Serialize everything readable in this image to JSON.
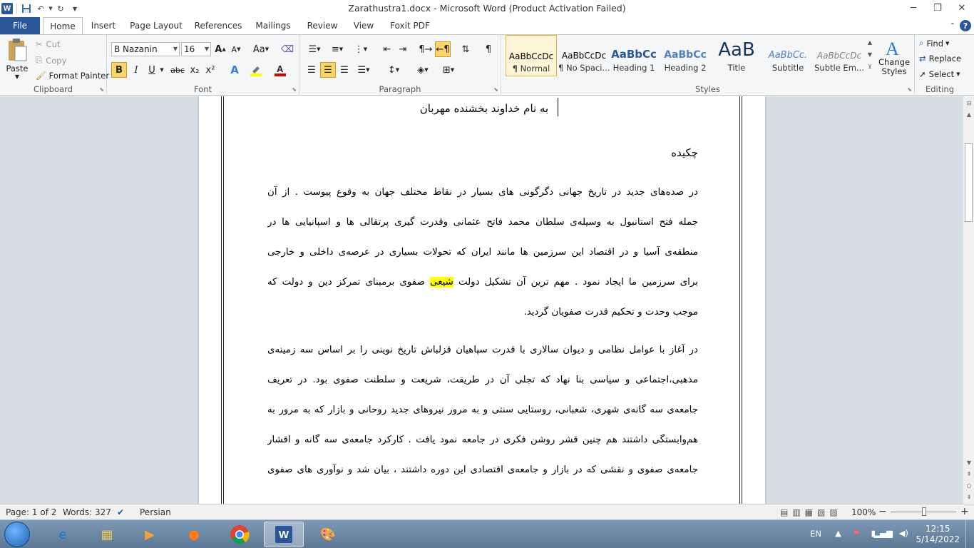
{
  "window": {
    "title": "Zarathustra1.docx  -  Microsoft Word (Product Activation Failed)",
    "minimize": "─",
    "restore": "❐",
    "close": "✕"
  },
  "qat": {
    "logo": "W",
    "save_icon": "save-icon",
    "undo_icon": "undo-icon",
    "redo_icon": "redo-icon"
  },
  "tabs": [
    "File",
    "Home",
    "Insert",
    "Page Layout",
    "References",
    "Mailings",
    "Review",
    "View",
    "Foxit PDF"
  ],
  "help": "?",
  "clipboard": {
    "label": "Clipboard",
    "paste": "Paste",
    "cut": "Cut",
    "copy": "Copy",
    "format_painter": "Format Painter"
  },
  "font": {
    "label": "Font",
    "family": "B Nazanin",
    "size": "16",
    "bold": "B",
    "italic": "I",
    "underline": "U",
    "strike": "abc",
    "subscript": "x₂",
    "superscript": "x²",
    "grow": "A",
    "shrink": "A",
    "change_case": "Aa",
    "text_effects": "A",
    "highlight_color": "#ffff00",
    "font_color": "#e00000"
  },
  "paragraph": {
    "label": "Paragraph",
    "pilcrow": "¶"
  },
  "styles": {
    "label": "Styles",
    "items": [
      {
        "preview": "AaBbCcDc",
        "label": "¶ Normal",
        "selected": true
      },
      {
        "preview": "AaBbCcDc",
        "label": "¶ No Spaci...",
        "selected": false
      },
      {
        "preview": "AaBbCc",
        "label": "Heading 1",
        "selected": false
      },
      {
        "preview": "AaBbCc",
        "label": "Heading 2",
        "selected": false
      },
      {
        "preview": "AaB",
        "label": "Title",
        "selected": false
      },
      {
        "preview": "AaBbCc.",
        "label": "Subtitle",
        "selected": false
      },
      {
        "preview": "AaBbCcDc",
        "label": "Subtle Em...",
        "selected": false
      }
    ],
    "change_styles": "Change Styles"
  },
  "editing": {
    "label": "Editing",
    "find": "Find",
    "replace": "Replace",
    "select": "Select"
  },
  "document": {
    "title": "به نام خداوند بخشنده مهربان",
    "heading": "چکیده",
    "para1": [
      "در صده‌های جدید در تاریخ جهانی دگرگونی های بسیار در نقاط مختلف جهان به وقوع پیوست . از آن",
      "جمله فتح استانبول به وسیله‌ی سلطان محمد فاتح عثمانی وقدرت گیری پرتقالی ها و اسپانیایی ها در",
      "منطقه‌ی آسیا و در اقتصاد این سرزمین ها مانند ایران که تحولات بسیاری در عرصه‌ی داخلی و خارجی"
    ],
    "para1_line4_before": "برای سرزمین ما ایجاد نمود . مهم ترین آن  تشکیل دولت ",
    "para1_line4_highlight": "شیعی",
    "para1_line4_after": " صفوی برمبنای تمرکز دین و دولت که",
    "para1_last": "موجب وحدت و تحکیم قدرت صفویان گردید.",
    "para2": [
      "در آغاز با عوامل نظامی و دیوان سالاری با قدرت سپاهیان قزلباش تاریخ نوینی را بر اساس سه زمینه‌ی",
      "مذهبی،اجتماعی و سیاسی بنا نهاد که تجلی آن در طریقت، شریعت و سلطنت صفوی بود. در تعریف",
      "جامعه‌ی سه گانه‌ی شهری، شعبانی، روستایی سنتی و به مرور نیروهای جدید روحانی و بازار که به مرور به",
      "هم‌وابستگی داشتند هم چنین قشر روشن فکری در جامعه نمود یافت . کارکرد جامعه‌ی سه گانه و اقشار",
      "جامعه‌ی صفوی و نقشی که در بازار و جامعه‌ی اقتصادی این دوره داشتند ، بیان شد و نوآوری های صفوی"
    ]
  },
  "statusbar": {
    "page": "Page: 1 of 2",
    "words": "Words: 327",
    "language": "Persian",
    "zoom": "100%",
    "zoom_minus": "−",
    "zoom_plus": "+"
  },
  "taskbar": {
    "apps": [
      "internet-explorer-icon",
      "file-explorer-icon",
      "media-player-icon",
      "firefox-icon",
      "chrome-icon",
      "word-icon",
      "paint-icon"
    ],
    "lang": "EN",
    "time": "12:15",
    "date": "5/14/2022"
  }
}
